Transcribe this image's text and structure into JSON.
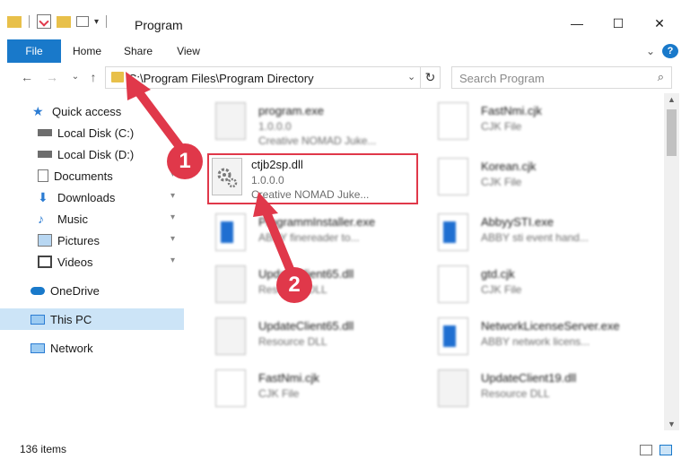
{
  "window": {
    "title": "Program",
    "minimize_glyph": "—",
    "maximize_glyph": "☐",
    "close_glyph": "✕"
  },
  "ribbon": {
    "tabs": [
      "File",
      "Home",
      "Share",
      "View"
    ],
    "expand_glyph": "⌄",
    "help_glyph": "?"
  },
  "nav": {
    "back_glyph": "←",
    "forward_glyph": "→",
    "recent_glyph": "⌄",
    "up_glyph": "↑",
    "address_path": "C:\\Program Files\\Program Directory",
    "address_dropdown_glyph": "⌄",
    "refresh_glyph": "↻",
    "search_placeholder": "Search Program",
    "search_glyph": "⌕"
  },
  "sidebar": {
    "items": [
      {
        "label": "Quick access",
        "icon": "star-icon"
      },
      {
        "label": "Local Disk (C:)",
        "icon": "drive-icon"
      },
      {
        "label": "Local Disk (D:)",
        "icon": "drive-icon"
      },
      {
        "label": "Documents",
        "icon": "documents-icon",
        "pinned": true
      },
      {
        "label": "Downloads",
        "icon": "download-icon",
        "pinned": true
      },
      {
        "label": "Music",
        "icon": "music-icon",
        "pinned": true
      },
      {
        "label": "Pictures",
        "icon": "pictures-icon",
        "pinned": true
      },
      {
        "label": "Videos",
        "icon": "videos-icon",
        "pinned": true
      },
      {
        "label": "OneDrive",
        "icon": "cloud-icon"
      },
      {
        "label": "This PC",
        "icon": "computer-icon",
        "selected": true
      },
      {
        "label": "Network",
        "icon": "network-icon"
      }
    ],
    "pin_glyph": "📌"
  },
  "files": [
    {
      "name": "program.exe",
      "sub1": "1.0.0.0",
      "sub2": "Creative NOMAD Juke...",
      "icon": "exe-icon",
      "blurred": true
    },
    {
      "name": "FastNmi.cjk",
      "sub1": "CJK File",
      "sub2": "",
      "icon": "document-icon",
      "blurred": true
    },
    {
      "name": "ctjb2sp.dll",
      "sub1": "1.0.0.0",
      "sub2": "Creative NOMAD Juke...",
      "icon": "dll-gear-icon",
      "blurred": false
    },
    {
      "name": "Korean.cjk",
      "sub1": "CJK File",
      "sub2": "",
      "icon": "document-icon",
      "blurred": true
    },
    {
      "name": "ProgrammInstaller.exe",
      "sub1": "ABBY finereader to...",
      "sub2": "",
      "icon": "exe-blue-icon",
      "blurred": true
    },
    {
      "name": "AbbyySTI.exe",
      "sub1": "ABBY sti event hand...",
      "sub2": "",
      "icon": "exe-blue-icon",
      "blurred": true
    },
    {
      "name": "UpdateClient65.dll",
      "sub1": "Resource DLL",
      "sub2": "",
      "icon": "dll-gear-icon",
      "blurred": true
    },
    {
      "name": "gtd.cjk",
      "sub1": "CJK File",
      "sub2": "",
      "icon": "document-icon",
      "blurred": true
    },
    {
      "name": "UpdateClient65.dll",
      "sub1": "Resource DLL",
      "sub2": "",
      "icon": "dll-gear-icon",
      "blurred": true
    },
    {
      "name": "NetworkLicenseServer.exe",
      "sub1": "ABBY network licens...",
      "sub2": "",
      "icon": "exe-blue-icon",
      "blurred": true
    },
    {
      "name": "FastNmi.cjk",
      "sub1": "CJK File",
      "sub2": "",
      "icon": "document-icon",
      "blurred": true
    },
    {
      "name": "UpdateClient19.dll",
      "sub1": "Resource DLL",
      "sub2": "",
      "icon": "dll-gear-icon",
      "blurred": true
    }
  ],
  "annotations": {
    "badge1": "1",
    "badge2": "2",
    "accent": "#e0384a"
  },
  "status": {
    "item_count": "136 items"
  },
  "colors": {
    "file_tab": "#1979ca",
    "selection": "#cce4f7",
    "highlight": "#e0384a"
  }
}
